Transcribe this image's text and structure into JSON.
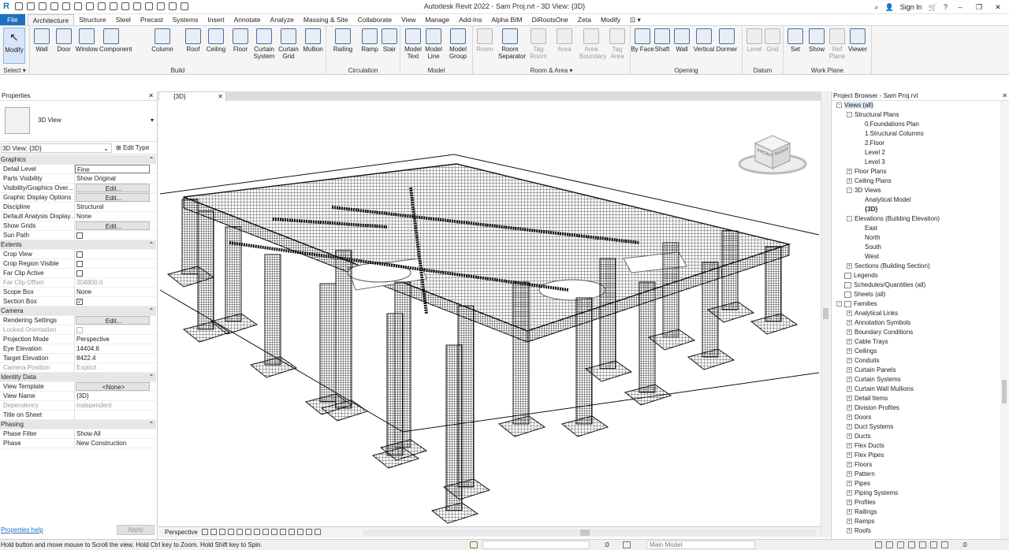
{
  "titlebar": {
    "app_initial": "R",
    "title": "Autodesk Revit 2022 - Sam Proj.rvt - 3D View: {3D}",
    "sign_in": "Sign In",
    "help": "?",
    "minimize": "–",
    "restore": "❐",
    "close": "✕"
  },
  "ribbon_tabs": [
    "File",
    "Architecture",
    "Structure",
    "Steel",
    "Precast",
    "Systems",
    "Insert",
    "Annotate",
    "Analyze",
    "Massing & Site",
    "Collaborate",
    "View",
    "Manage",
    "Add-Ins",
    "Alpha BIM",
    "DiRootsOne",
    "Zeta",
    "Modify"
  ],
  "active_tab": "Architecture",
  "panels": {
    "select": {
      "label": "Select",
      "modify": "Modify"
    },
    "build": {
      "label": "Build",
      "tools": [
        "Wall",
        "Door",
        "Window",
        "Component",
        "Column",
        "Roof",
        "Ceiling",
        "Floor",
        "Curtain System",
        "Curtain Grid",
        "Mullion"
      ]
    },
    "circulation": {
      "label": "Circulation",
      "tools": [
        "Railing",
        "Ramp",
        "Stair"
      ]
    },
    "model": {
      "label": "Model",
      "tools": [
        "Model Text",
        "Model Line",
        "Model Group"
      ]
    },
    "room_area": {
      "label": "Room & Area",
      "tools": [
        "Room",
        "Room Separator",
        "Tag Room",
        "Area",
        "Area Boundary",
        "Tag Area"
      ]
    },
    "opening": {
      "label": "Opening",
      "tools": [
        "By Face",
        "Shaft",
        "Wall",
        "Vertical",
        "Dormer"
      ]
    },
    "datum": {
      "label": "Datum",
      "tools": [
        "Level",
        "Grid"
      ]
    },
    "work_plane": {
      "label": "Work Plane",
      "tools": [
        "Set",
        "Show",
        "Ref Plane",
        "Viewer"
      ]
    }
  },
  "properties": {
    "header": "Properties",
    "type_name": "3D View",
    "view_selector": "3D View: {3D}",
    "edit_type": "Edit Type",
    "rows": [
      {
        "kind": "cat",
        "k": "Graphics"
      },
      {
        "k": "Detail Level",
        "v": "Fine",
        "style": "field"
      },
      {
        "k": "Parts Visibility",
        "v": "Show Original"
      },
      {
        "k": "Visibility/Graphics Over...",
        "v": "Edit...",
        "style": "btn"
      },
      {
        "k": "Graphic Display Options",
        "v": "Edit...",
        "style": "btn"
      },
      {
        "k": "Discipline",
        "v": "Structural"
      },
      {
        "k": "Default Analysis Display...",
        "v": "None"
      },
      {
        "k": "Show Grids",
        "v": "Edit...",
        "style": "btn"
      },
      {
        "k": "Sun Path",
        "v": "",
        "style": "chk"
      },
      {
        "kind": "cat",
        "k": "Extents"
      },
      {
        "k": "Crop View",
        "v": "",
        "style": "chk"
      },
      {
        "k": "Crop Region Visible",
        "v": "",
        "style": "chk"
      },
      {
        "k": "Far Clip Active",
        "v": "",
        "style": "chk"
      },
      {
        "k": "Far Clip Offset",
        "v": "304800.0",
        "dis": true
      },
      {
        "k": "Scope Box",
        "v": "None"
      },
      {
        "k": "Section Box",
        "v": "✓",
        "style": "chk"
      },
      {
        "kind": "cat",
        "k": "Camera"
      },
      {
        "k": "Rendering Settings",
        "v": "Edit...",
        "style": "btn"
      },
      {
        "k": "Locked Orientation",
        "v": "",
        "style": "chkgray",
        "dis": true
      },
      {
        "k": "Projection Mode",
        "v": "Perspective"
      },
      {
        "k": "Eye Elevation",
        "v": "14404.6"
      },
      {
        "k": "Target Elevation",
        "v": "8422.4"
      },
      {
        "k": "Camera Position",
        "v": "Explicit",
        "dis": true
      },
      {
        "kind": "cat",
        "k": "Identity Data"
      },
      {
        "k": "View Template",
        "v": "<None>",
        "style": "btn"
      },
      {
        "k": "View Name",
        "v": "{3D}"
      },
      {
        "k": "Dependency",
        "v": "Independent",
        "dis": true
      },
      {
        "k": "Title on Sheet",
        "v": ""
      },
      {
        "kind": "cat",
        "k": "Phasing"
      },
      {
        "k": "Phase Filter",
        "v": "Show All"
      },
      {
        "k": "Phase",
        "v": "New Construction"
      }
    ],
    "help_link": "Properties help",
    "apply": "Apply"
  },
  "view_tab": "{3D}",
  "view_cube": {
    "front": "FRONT",
    "right": "RIGHT"
  },
  "view_control": {
    "mode": "Perspective"
  },
  "project_browser": {
    "header": "Project Browser - Sam Proj.rvt",
    "tree": [
      {
        "d": 0,
        "t": "Views (all)",
        "tg": "-",
        "sel": true
      },
      {
        "d": 1,
        "t": "Structural Plans",
        "tg": "-"
      },
      {
        "d": 2,
        "t": "0.Foundations Plan"
      },
      {
        "d": 2,
        "t": "1.Structural Columns"
      },
      {
        "d": 2,
        "t": "2.Floor"
      },
      {
        "d": 2,
        "t": "Level 2"
      },
      {
        "d": 2,
        "t": "Level 3"
      },
      {
        "d": 1,
        "t": "Floor Plans",
        "tg": "+"
      },
      {
        "d": 1,
        "t": "Ceiling Plans",
        "tg": "+"
      },
      {
        "d": 1,
        "t": "3D Views",
        "tg": "-"
      },
      {
        "d": 2,
        "t": "Analytical Model"
      },
      {
        "d": 2,
        "t": "{3D}",
        "bold": true
      },
      {
        "d": 1,
        "t": "Elevations (Building Elevation)",
        "tg": "-"
      },
      {
        "d": 2,
        "t": "East"
      },
      {
        "d": 2,
        "t": "North"
      },
      {
        "d": 2,
        "t": "South"
      },
      {
        "d": 2,
        "t": "West"
      },
      {
        "d": 1,
        "t": "Sections (Building Section)",
        "tg": "+"
      },
      {
        "d": 0,
        "t": "Legends",
        "icon": true
      },
      {
        "d": 0,
        "t": "Schedules/Quantities (all)",
        "icon": true
      },
      {
        "d": 0,
        "t": "Sheets (all)",
        "icon": true
      },
      {
        "d": 0,
        "t": "Families",
        "tg": "-",
        "icon": true
      },
      {
        "d": 1,
        "t": "Analytical Links",
        "tg": "+"
      },
      {
        "d": 1,
        "t": "Annotation Symbols",
        "tg": "+"
      },
      {
        "d": 1,
        "t": "Boundary Conditions",
        "tg": "+"
      },
      {
        "d": 1,
        "t": "Cable Trays",
        "tg": "+"
      },
      {
        "d": 1,
        "t": "Ceilings",
        "tg": "+"
      },
      {
        "d": 1,
        "t": "Conduits",
        "tg": "+"
      },
      {
        "d": 1,
        "t": "Curtain Panels",
        "tg": "+"
      },
      {
        "d": 1,
        "t": "Curtain Systems",
        "tg": "+"
      },
      {
        "d": 1,
        "t": "Curtain Wall Mullions",
        "tg": "+"
      },
      {
        "d": 1,
        "t": "Detail Items",
        "tg": "+"
      },
      {
        "d": 1,
        "t": "Division Profiles",
        "tg": "+"
      },
      {
        "d": 1,
        "t": "Doors",
        "tg": "+"
      },
      {
        "d": 1,
        "t": "Duct Systems",
        "tg": "+"
      },
      {
        "d": 1,
        "t": "Ducts",
        "tg": "+"
      },
      {
        "d": 1,
        "t": "Flex Ducts",
        "tg": "+"
      },
      {
        "d": 1,
        "t": "Flex Pipes",
        "tg": "+"
      },
      {
        "d": 1,
        "t": "Floors",
        "tg": "+"
      },
      {
        "d": 1,
        "t": "Pattern",
        "tg": "+"
      },
      {
        "d": 1,
        "t": "Pipes",
        "tg": "+"
      },
      {
        "d": 1,
        "t": "Piping Systems",
        "tg": "+"
      },
      {
        "d": 1,
        "t": "Profiles",
        "tg": "+"
      },
      {
        "d": 1,
        "t": "Railings",
        "tg": "+"
      },
      {
        "d": 1,
        "t": "Ramps",
        "tg": "+"
      },
      {
        "d": 1,
        "t": "Roofs",
        "tg": "+"
      }
    ]
  },
  "statusbar": {
    "message": "Hold button and move mouse to Scroll the view. Hold Ctrl key to Zoom. Hold Shift key to Spin.",
    "zero": ":0",
    "model": "Main Model",
    "filter": ":0"
  }
}
